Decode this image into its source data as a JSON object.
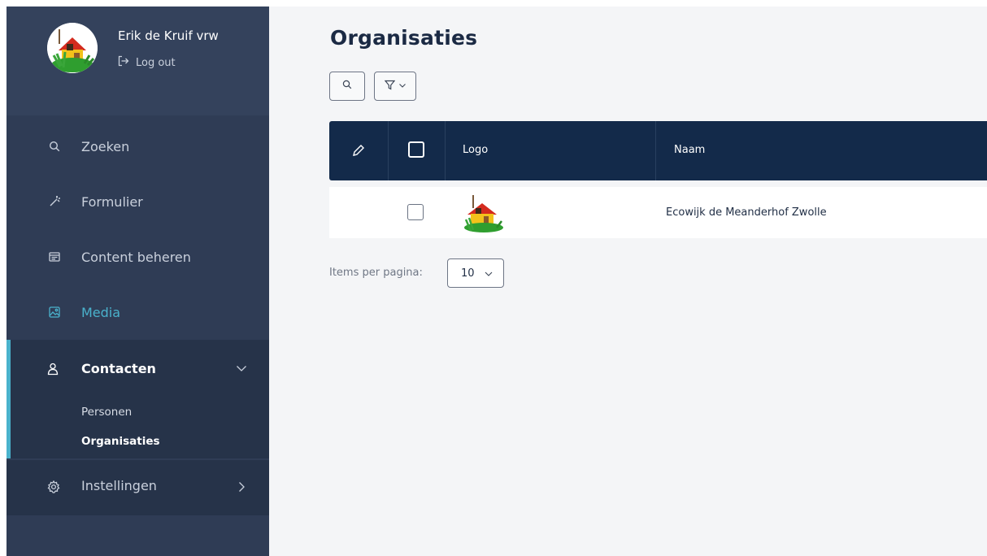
{
  "user": {
    "name": "Erik de Kruif vrw",
    "logout_label": "Log out"
  },
  "nav": {
    "search": "Zoeken",
    "form": "Formulier",
    "content": "Content beheren",
    "media": "Media",
    "contacts": {
      "label": "Contacten",
      "persons": "Personen",
      "organisations": "Organisaties"
    },
    "settings": "Instellingen"
  },
  "page": {
    "title": "Organisaties"
  },
  "table": {
    "columns": [
      "Logo",
      "Naam"
    ],
    "rows": [
      {
        "name": "Ecowijk de Meanderhof Zwolle"
      }
    ]
  },
  "pagination": {
    "items_per_page_label": "Items per pagina:",
    "items_per_page_value": "10"
  },
  "colors": {
    "sidebar": "#2f3c55",
    "accent": "#4ab2cc",
    "table_header": "#132a4a"
  }
}
